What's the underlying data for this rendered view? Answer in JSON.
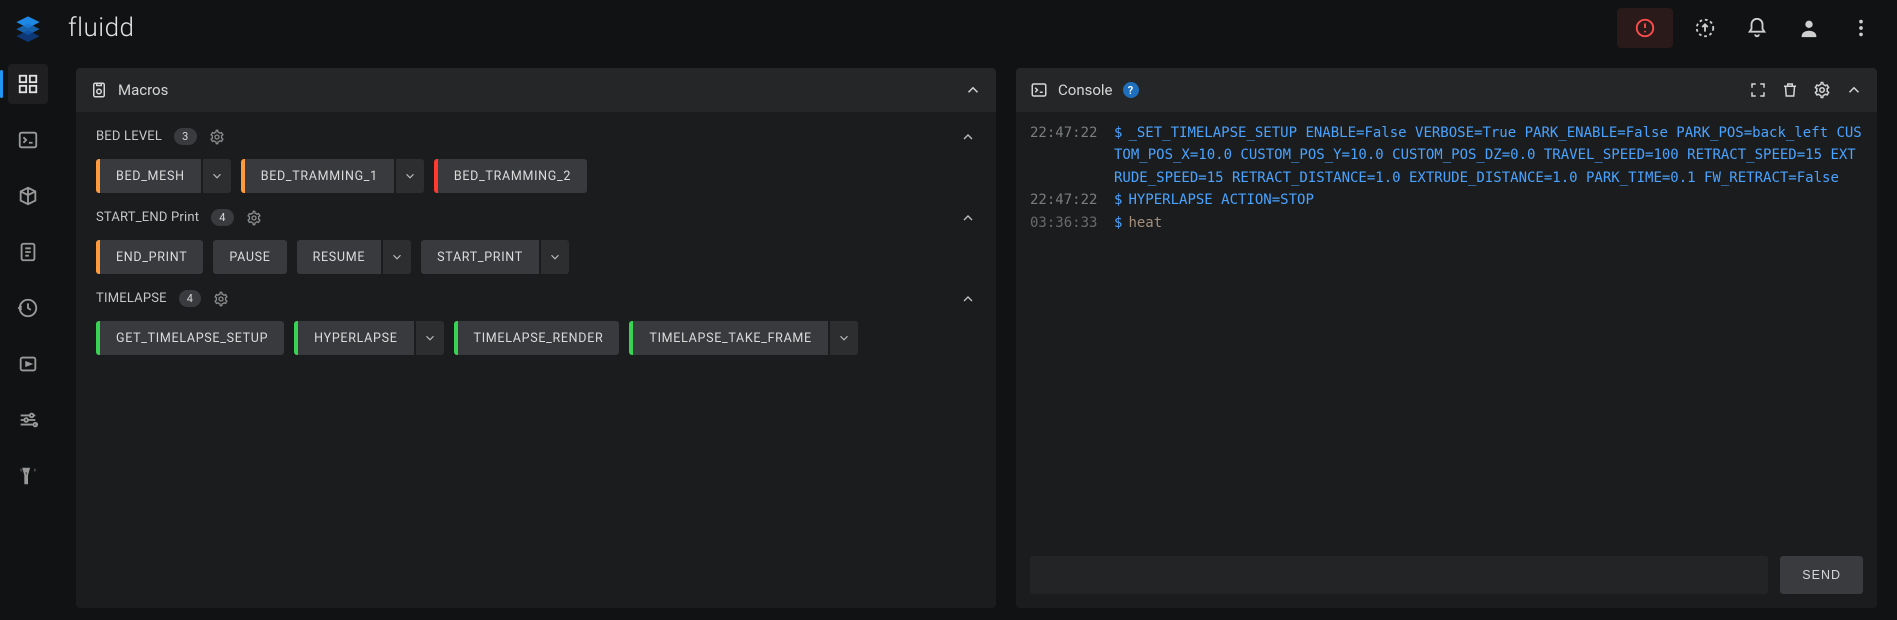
{
  "app_title": "fluidd",
  "topbar": {
    "alert": "estop",
    "uploads": "uploads",
    "notifications": "notifications",
    "user": "user",
    "more": "more"
  },
  "sidebar": {
    "items": [
      {
        "name": "dashboard",
        "active": true
      },
      {
        "name": "console"
      },
      {
        "name": "gcode-preview"
      },
      {
        "name": "jobs"
      },
      {
        "name": "history"
      },
      {
        "name": "timelapse"
      },
      {
        "name": "tune"
      },
      {
        "name": "configure"
      }
    ]
  },
  "macros": {
    "title": "Macros",
    "categories": [
      {
        "name": "BED LEVEL",
        "count": 3,
        "items": [
          {
            "label": "BED_MESH",
            "accent": "orange",
            "dropdown": true
          },
          {
            "label": "BED_TRAMMING_1",
            "accent": "orange",
            "dropdown": true
          },
          {
            "label": "BED_TRAMMING_2",
            "accent": "red",
            "dropdown": false
          }
        ]
      },
      {
        "name": "START_END Print",
        "count": 4,
        "items": [
          {
            "label": "END_PRINT",
            "accent": "orange",
            "dropdown": false
          },
          {
            "label": "PAUSE",
            "accent": "",
            "dropdown": false
          },
          {
            "label": "RESUME",
            "accent": "",
            "dropdown": true
          },
          {
            "label": "START_PRINT",
            "accent": "",
            "dropdown": true
          }
        ]
      },
      {
        "name": "TIMELAPSE",
        "count": 4,
        "items": [
          {
            "label": "GET_TIMELAPSE_SETUP",
            "accent": "green",
            "dropdown": false
          },
          {
            "label": "HYPERLAPSE",
            "accent": "green",
            "dropdown": true
          },
          {
            "label": "TIMELAPSE_RENDER",
            "accent": "green",
            "dropdown": false
          },
          {
            "label": "TIMELAPSE_TAKE_FRAME",
            "accent": "green",
            "dropdown": true
          }
        ]
      }
    ]
  },
  "console": {
    "title": "Console",
    "entries": [
      {
        "time": "22:47:22",
        "text": "_SET_TIMELAPSE_SETUP ENABLE=False VERBOSE=True PARK_ENABLE=False PARK_POS=back_left CUSTOM_POS_X=10.0 CUSTOM_POS_Y=10.0 CUSTOM_POS_DZ=0.0 TRAVEL_SPEED=100 RETRACT_SPEED=15 EXTRUDE_SPEED=15 RETRACT_DISTANCE=1.0 EXTRUDE_DISTANCE=1.0 PARK_TIME=0.1 FW_RETRACT=False",
        "style": "cmd"
      },
      {
        "time": "22:47:22",
        "text": "HYPERLAPSE ACTION=STOP",
        "style": "cmd"
      },
      {
        "time": "03:36:33",
        "text": "heat",
        "style": "pale"
      }
    ],
    "send_label": "SEND",
    "input_placeholder": ""
  }
}
